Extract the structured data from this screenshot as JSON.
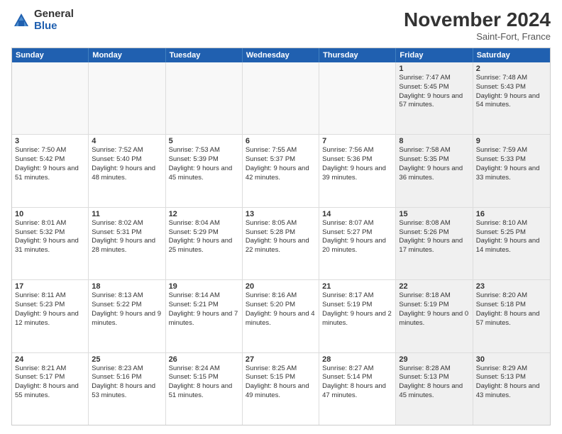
{
  "logo": {
    "general": "General",
    "blue": "Blue"
  },
  "title": "November 2024",
  "location": "Saint-Fort, France",
  "headers": [
    "Sunday",
    "Monday",
    "Tuesday",
    "Wednesday",
    "Thursday",
    "Friday",
    "Saturday"
  ],
  "rows": [
    [
      {
        "day": "",
        "text": "",
        "empty": true
      },
      {
        "day": "",
        "text": "",
        "empty": true
      },
      {
        "day": "",
        "text": "",
        "empty": true
      },
      {
        "day": "",
        "text": "",
        "empty": true
      },
      {
        "day": "",
        "text": "",
        "empty": true
      },
      {
        "day": "1",
        "text": "Sunrise: 7:47 AM\nSunset: 5:45 PM\nDaylight: 9 hours and 57 minutes.",
        "empty": false,
        "shaded": true
      },
      {
        "day": "2",
        "text": "Sunrise: 7:48 AM\nSunset: 5:43 PM\nDaylight: 9 hours and 54 minutes.",
        "empty": false,
        "shaded": true
      }
    ],
    [
      {
        "day": "3",
        "text": "Sunrise: 7:50 AM\nSunset: 5:42 PM\nDaylight: 9 hours and 51 minutes.",
        "empty": false
      },
      {
        "day": "4",
        "text": "Sunrise: 7:52 AM\nSunset: 5:40 PM\nDaylight: 9 hours and 48 minutes.",
        "empty": false
      },
      {
        "day": "5",
        "text": "Sunrise: 7:53 AM\nSunset: 5:39 PM\nDaylight: 9 hours and 45 minutes.",
        "empty": false
      },
      {
        "day": "6",
        "text": "Sunrise: 7:55 AM\nSunset: 5:37 PM\nDaylight: 9 hours and 42 minutes.",
        "empty": false
      },
      {
        "day": "7",
        "text": "Sunrise: 7:56 AM\nSunset: 5:36 PM\nDaylight: 9 hours and 39 minutes.",
        "empty": false
      },
      {
        "day": "8",
        "text": "Sunrise: 7:58 AM\nSunset: 5:35 PM\nDaylight: 9 hours and 36 minutes.",
        "empty": false,
        "shaded": true
      },
      {
        "day": "9",
        "text": "Sunrise: 7:59 AM\nSunset: 5:33 PM\nDaylight: 9 hours and 33 minutes.",
        "empty": false,
        "shaded": true
      }
    ],
    [
      {
        "day": "10",
        "text": "Sunrise: 8:01 AM\nSunset: 5:32 PM\nDaylight: 9 hours and 31 minutes.",
        "empty": false
      },
      {
        "day": "11",
        "text": "Sunrise: 8:02 AM\nSunset: 5:31 PM\nDaylight: 9 hours and 28 minutes.",
        "empty": false
      },
      {
        "day": "12",
        "text": "Sunrise: 8:04 AM\nSunset: 5:29 PM\nDaylight: 9 hours and 25 minutes.",
        "empty": false
      },
      {
        "day": "13",
        "text": "Sunrise: 8:05 AM\nSunset: 5:28 PM\nDaylight: 9 hours and 22 minutes.",
        "empty": false
      },
      {
        "day": "14",
        "text": "Sunrise: 8:07 AM\nSunset: 5:27 PM\nDaylight: 9 hours and 20 minutes.",
        "empty": false
      },
      {
        "day": "15",
        "text": "Sunrise: 8:08 AM\nSunset: 5:26 PM\nDaylight: 9 hours and 17 minutes.",
        "empty": false,
        "shaded": true
      },
      {
        "day": "16",
        "text": "Sunrise: 8:10 AM\nSunset: 5:25 PM\nDaylight: 9 hours and 14 minutes.",
        "empty": false,
        "shaded": true
      }
    ],
    [
      {
        "day": "17",
        "text": "Sunrise: 8:11 AM\nSunset: 5:23 PM\nDaylight: 9 hours and 12 minutes.",
        "empty": false
      },
      {
        "day": "18",
        "text": "Sunrise: 8:13 AM\nSunset: 5:22 PM\nDaylight: 9 hours and 9 minutes.",
        "empty": false
      },
      {
        "day": "19",
        "text": "Sunrise: 8:14 AM\nSunset: 5:21 PM\nDaylight: 9 hours and 7 minutes.",
        "empty": false
      },
      {
        "day": "20",
        "text": "Sunrise: 8:16 AM\nSunset: 5:20 PM\nDaylight: 9 hours and 4 minutes.",
        "empty": false
      },
      {
        "day": "21",
        "text": "Sunrise: 8:17 AM\nSunset: 5:19 PM\nDaylight: 9 hours and 2 minutes.",
        "empty": false
      },
      {
        "day": "22",
        "text": "Sunrise: 8:18 AM\nSunset: 5:19 PM\nDaylight: 9 hours and 0 minutes.",
        "empty": false,
        "shaded": true
      },
      {
        "day": "23",
        "text": "Sunrise: 8:20 AM\nSunset: 5:18 PM\nDaylight: 8 hours and 57 minutes.",
        "empty": false,
        "shaded": true
      }
    ],
    [
      {
        "day": "24",
        "text": "Sunrise: 8:21 AM\nSunset: 5:17 PM\nDaylight: 8 hours and 55 minutes.",
        "empty": false
      },
      {
        "day": "25",
        "text": "Sunrise: 8:23 AM\nSunset: 5:16 PM\nDaylight: 8 hours and 53 minutes.",
        "empty": false
      },
      {
        "day": "26",
        "text": "Sunrise: 8:24 AM\nSunset: 5:15 PM\nDaylight: 8 hours and 51 minutes.",
        "empty": false
      },
      {
        "day": "27",
        "text": "Sunrise: 8:25 AM\nSunset: 5:15 PM\nDaylight: 8 hours and 49 minutes.",
        "empty": false
      },
      {
        "day": "28",
        "text": "Sunrise: 8:27 AM\nSunset: 5:14 PM\nDaylight: 8 hours and 47 minutes.",
        "empty": false
      },
      {
        "day": "29",
        "text": "Sunrise: 8:28 AM\nSunset: 5:13 PM\nDaylight: 8 hours and 45 minutes.",
        "empty": false,
        "shaded": true
      },
      {
        "day": "30",
        "text": "Sunrise: 8:29 AM\nSunset: 5:13 PM\nDaylight: 8 hours and 43 minutes.",
        "empty": false,
        "shaded": true
      }
    ]
  ]
}
